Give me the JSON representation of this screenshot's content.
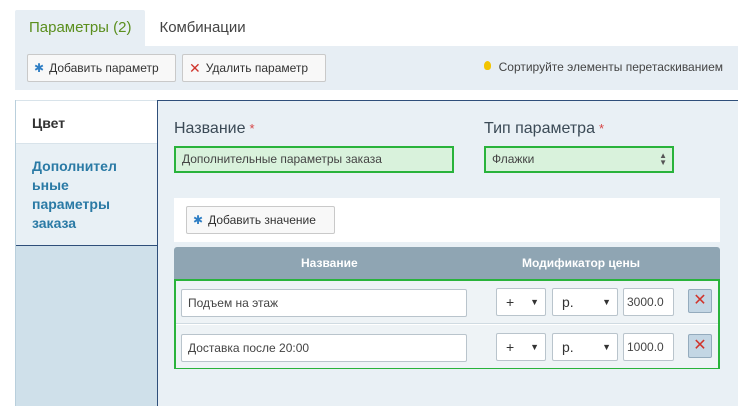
{
  "tabs": [
    {
      "label": "Параметры (2)",
      "active": true
    },
    {
      "label": "Комбинации",
      "active": false
    }
  ],
  "toolbar": {
    "add_param_label": "Добавить параметр",
    "remove_param_label": "Удалить параметр",
    "sort_hint": "Сортируйте элементы перетаскиванием"
  },
  "sidebar": {
    "items": [
      {
        "label": "Цвет",
        "active": false
      },
      {
        "label": "Дополнител ьные параметры заказа",
        "active": true
      }
    ]
  },
  "form": {
    "name_label": "Название",
    "name_required": "*",
    "name_value": "Дополнительные параметры заказа",
    "type_label": "Тип параметра",
    "type_required": "*",
    "type_value": "Флажки",
    "add_value_label": "Добавить значение"
  },
  "table": {
    "col_name": "Название",
    "col_modifier": "Модификатор цены",
    "rows": [
      {
        "name": "Подъем на этаж",
        "sign": "+",
        "unit": "р.",
        "amount": "3000.0"
      },
      {
        "name": "Доставка после 20:00",
        "sign": "+",
        "unit": "р.",
        "amount": "1000.0"
      }
    ]
  },
  "colors": {
    "accent_green": "#29b33b",
    "active_tab_text": "#5b8f1e",
    "sidebar_link": "#2a7aa5",
    "delete_red": "#d0342c"
  }
}
